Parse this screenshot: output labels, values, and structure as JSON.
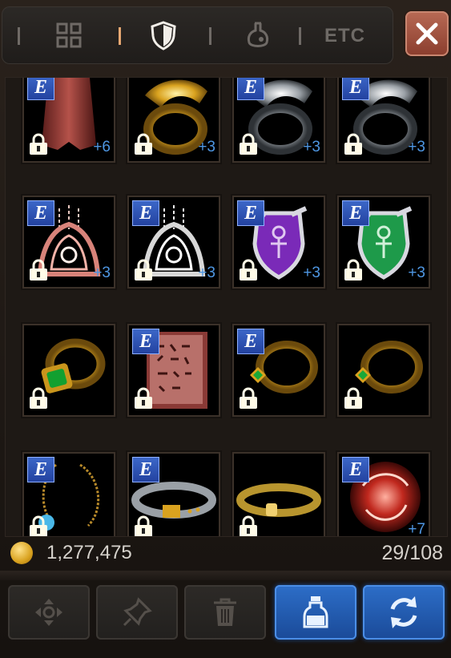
{
  "tabs": [
    {
      "name": "all-items",
      "icon": "grid-icon",
      "active": false
    },
    {
      "name": "equipment",
      "icon": "shield-icon",
      "active": true
    },
    {
      "name": "consumables",
      "icon": "potion-icon",
      "active": false
    },
    {
      "name": "etc",
      "label": "ETC",
      "active": false
    }
  ],
  "close_icon": "close-icon",
  "inventory": {
    "slots": [
      {
        "item": "red-cape-icon",
        "equip_badge": "E",
        "locked": true,
        "enhance": "+6"
      },
      {
        "item": "gold-dragon-ring-icon",
        "equip_badge": "",
        "locked": true,
        "enhance": "+3"
      },
      {
        "item": "silver-dragon-ring-icon",
        "equip_badge": "E",
        "locked": true,
        "enhance": "+3"
      },
      {
        "item": "silver-dragon-ring-icon",
        "equip_badge": "E",
        "locked": true,
        "enhance": "+3"
      },
      {
        "item": "red-earring-icon",
        "equip_badge": "E",
        "locked": true,
        "enhance": "+3"
      },
      {
        "item": "white-earring-icon",
        "equip_badge": "E",
        "locked": true,
        "enhance": "+3"
      },
      {
        "item": "purple-ankh-shield-icon",
        "equip_badge": "E",
        "locked": true,
        "enhance": "+3"
      },
      {
        "item": "green-ankh-shield-icon",
        "equip_badge": "E",
        "locked": true,
        "enhance": "+3"
      },
      {
        "item": "emerald-ring-icon",
        "equip_badge": "",
        "locked": true,
        "enhance": ""
      },
      {
        "item": "rune-tablet-icon",
        "equip_badge": "E",
        "locked": true,
        "enhance": ""
      },
      {
        "item": "gold-gem-ring-icon",
        "equip_badge": "E",
        "locked": true,
        "enhance": ""
      },
      {
        "item": "gold-gem-ring-icon",
        "equip_badge": "",
        "locked": true,
        "enhance": ""
      },
      {
        "item": "amulet-necklace-icon",
        "equip_badge": "E",
        "locked": true,
        "enhance": ""
      },
      {
        "item": "silver-belt-icon",
        "equip_badge": "E",
        "locked": true,
        "enhance": ""
      },
      {
        "item": "gold-belt-icon",
        "equip_badge": "",
        "locked": true,
        "enhance": ""
      },
      {
        "item": "red-orb-ring-icon",
        "equip_badge": "E",
        "locked": false,
        "enhance": "+7"
      }
    ]
  },
  "footer": {
    "gold_icon": "gold-coin-icon",
    "gold_amount": "1,277,475",
    "capacity": "29/108"
  },
  "actions": [
    {
      "name": "move-button",
      "icon": "move-arrows-icon",
      "highlighted": false
    },
    {
      "name": "pin-button",
      "icon": "pin-icon",
      "highlighted": false
    },
    {
      "name": "delete-button",
      "icon": "trash-icon",
      "highlighted": false
    },
    {
      "name": "potion-button",
      "icon": "potion-bottle-icon",
      "highlighted": true
    },
    {
      "name": "refresh-button",
      "icon": "refresh-icon",
      "highlighted": true
    }
  ],
  "colors": {
    "accent_blue": "#2d6ec8",
    "close_red": "#b86a55",
    "enhance_blue": "#4e96e2",
    "active_tab": "#e7a872"
  }
}
